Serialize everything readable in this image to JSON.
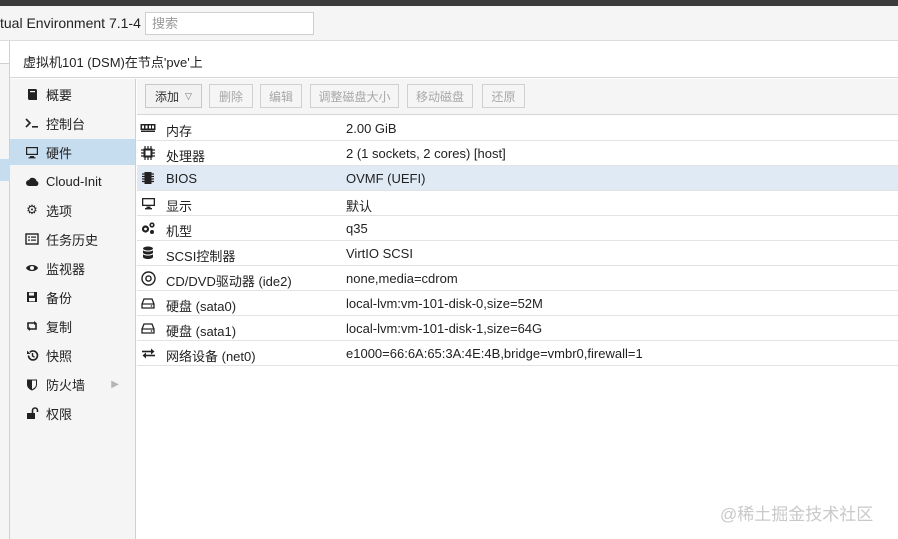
{
  "app": {
    "title": "tual Environment 7.1-4"
  },
  "search": {
    "placeholder": "搜索"
  },
  "vm_header": {
    "text": "虚拟机101 (DSM)在节点'pve'上"
  },
  "nav": {
    "items": [
      {
        "label": "概要",
        "icon": "book-icon"
      },
      {
        "label": "控制台",
        "icon": "terminal-icon"
      },
      {
        "label": "硬件",
        "icon": "desktop-icon",
        "active": true
      },
      {
        "label": "Cloud-Init",
        "icon": "cloud-icon"
      },
      {
        "label": "选项",
        "icon": "gear-icon"
      },
      {
        "label": "任务历史",
        "icon": "list-icon"
      },
      {
        "label": "监视器",
        "icon": "eye-icon"
      },
      {
        "label": "备份",
        "icon": "floppy-icon"
      },
      {
        "label": "复制",
        "icon": "retweet-icon"
      },
      {
        "label": "快照",
        "icon": "history-icon"
      },
      {
        "label": "防火墙",
        "icon": "shield-icon"
      },
      {
        "label": "权限",
        "icon": "unlock-icon"
      }
    ]
  },
  "toolbar": {
    "add": "添加",
    "remove": "删除",
    "edit": "编辑",
    "resize": "调整磁盘大小",
    "move": "移动磁盘",
    "revert": "还原"
  },
  "hardware": {
    "rows": [
      {
        "name": "内存",
        "value": "2.00 GiB",
        "icon": "memory-icon"
      },
      {
        "name": "处理器",
        "value": "2 (1 sockets, 2 cores) [host]",
        "icon": "cpu-icon"
      },
      {
        "name": "BIOS",
        "value": "OVMF (UEFI)",
        "icon": "microchip-icon",
        "selected": true
      },
      {
        "name": "显示",
        "value": "默认",
        "icon": "desktop-icon"
      },
      {
        "name": "机型",
        "value": "q35",
        "icon": "cogs-icon"
      },
      {
        "name": "SCSI控制器",
        "value": "VirtIO SCSI",
        "icon": "database-icon"
      },
      {
        "name": "CD/DVD驱动器 (ide2)",
        "value": "none,media=cdrom",
        "icon": "cdrom-icon"
      },
      {
        "name": "硬盘 (sata0)",
        "value": "local-lvm:vm-101-disk-0,size=52M",
        "icon": "hdd-icon"
      },
      {
        "name": "硬盘 (sata1)",
        "value": "local-lvm:vm-101-disk-1,size=64G",
        "icon": "hdd-icon"
      },
      {
        "name": "网络设备 (net0)",
        "value": "e1000=66:6A:65:3A:4E:4B,bridge=vmbr0,firewall=1",
        "icon": "exchange-icon"
      }
    ]
  },
  "watermark": {
    "text": "@稀土掘金技术社区"
  }
}
